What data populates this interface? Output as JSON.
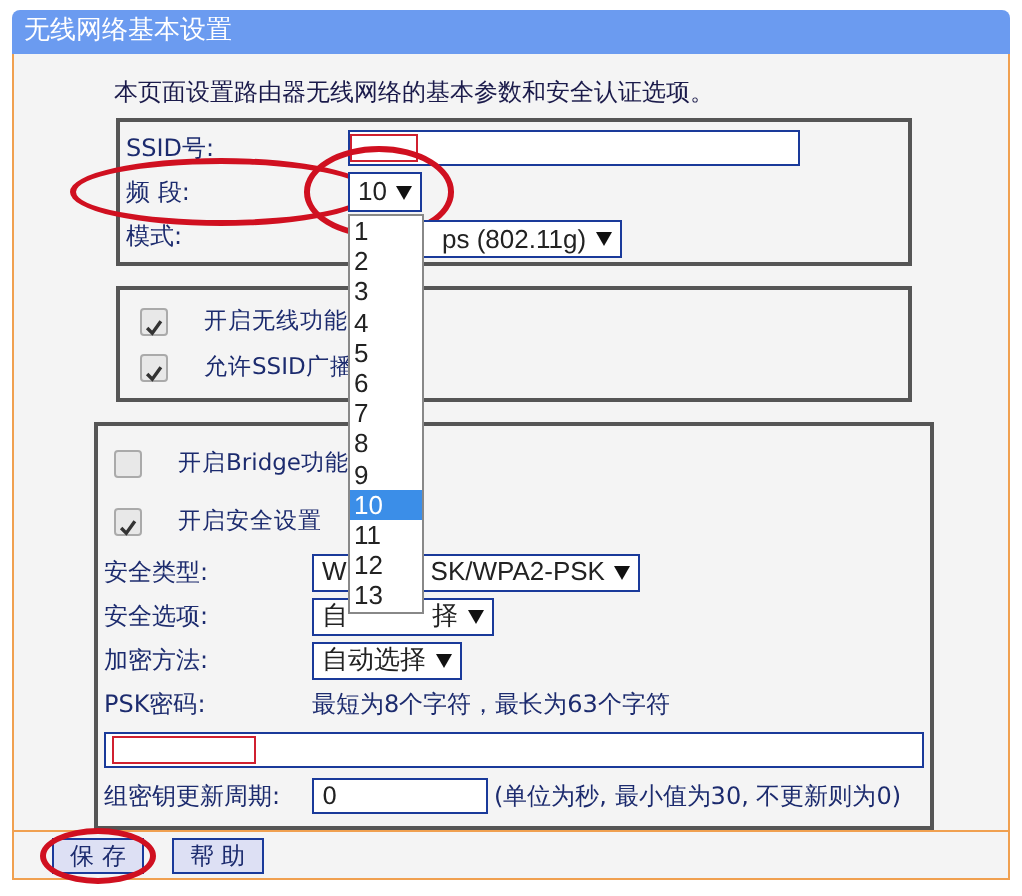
{
  "title": "无线网络基本设置",
  "description": "本页面设置路由器无线网络的基本参数和安全认证选项。",
  "basic_fields": [
    {
      "kind": "text",
      "label": "SSID号:",
      "redacted": true
    },
    {
      "kind": "select",
      "label": "频 段:",
      "value_parts": [
        "10"
      ],
      "label_circled": true,
      "value_circled": true,
      "options": [
        {
          "label": "1",
          "selected": false
        },
        {
          "label": "2",
          "selected": false
        },
        {
          "label": "3",
          "selected": false
        },
        {
          "label": "4",
          "selected": false
        },
        {
          "label": "5",
          "selected": false
        },
        {
          "label": "6",
          "selected": false
        },
        {
          "label": "7",
          "selected": false
        },
        {
          "label": "8",
          "selected": false
        },
        {
          "label": "9",
          "selected": false
        },
        {
          "label": "10",
          "selected": true
        },
        {
          "label": "11",
          "selected": false
        },
        {
          "label": "12",
          "selected": false
        },
        {
          "label": "13",
          "selected": false
        }
      ]
    },
    {
      "kind": "select",
      "label": "模式:",
      "value_parts": [
        "ps (802.11g)"
      ],
      "covered_start": true
    }
  ],
  "wireless_toggles": [
    {
      "label": "开启无线功能",
      "checked": true
    },
    {
      "label": "允许SSID广播",
      "checked": true
    }
  ],
  "security_toggles": [
    {
      "label": "开启Bridge功能",
      "checked": false
    },
    {
      "label": "开启安全设置",
      "checked": true
    }
  ],
  "security_fields": [
    {
      "kind": "select",
      "label": "安全类型:",
      "value_parts": [
        "W",
        "SK/WPA2-PSK"
      ]
    },
    {
      "kind": "select",
      "label": "安全选项:",
      "value_parts": [
        "自",
        "择"
      ]
    },
    {
      "kind": "select",
      "label": "加密方法:",
      "value_parts": [
        "自动选择"
      ]
    },
    {
      "kind": "hint",
      "label": "PSK密码:",
      "text": "最短为8个字符，最长为63个字符"
    },
    {
      "kind": "wide_text",
      "redacted": true
    },
    {
      "kind": "text",
      "label": "组密钥更新周期:",
      "value": "0",
      "note": "(单位为秒, 最小值为30, 不更新则为0)"
    }
  ],
  "buttons": [
    {
      "label": "保 存",
      "circled": true
    },
    {
      "label": "帮 助",
      "circled": false
    }
  ]
}
